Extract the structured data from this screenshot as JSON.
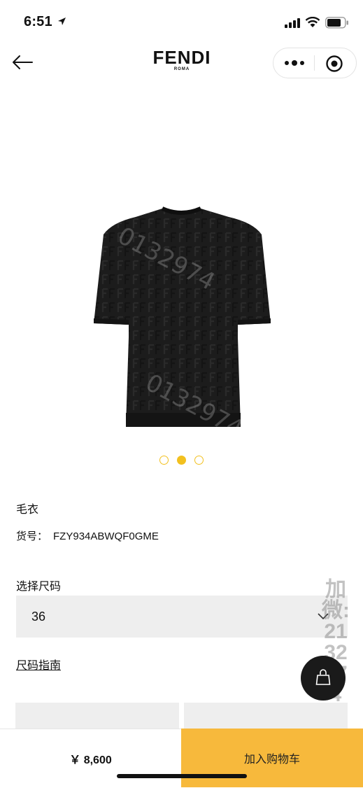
{
  "status_bar": {
    "time": "6:51"
  },
  "nav": {
    "brand": "FENDI",
    "brand_sub": "ROMA"
  },
  "product": {
    "image_watermark_1": "0132974",
    "image_watermark_2": "0132974",
    "name": "毛衣",
    "sku_label": "货号：",
    "sku": "FZY934ABWQF0GME"
  },
  "pager": {
    "count": 3,
    "active_index": 1
  },
  "size": {
    "label": "选择尺码",
    "selected": "36",
    "guide_link": "尺码指南"
  },
  "side_watermark": "加微:2132974",
  "bottom": {
    "price": "￥ 8,600",
    "add_to_cart": "加入购物车"
  },
  "colors": {
    "accent": "#f7b93c",
    "dot": "#f2c01f",
    "fab": "#1a1a1a"
  }
}
